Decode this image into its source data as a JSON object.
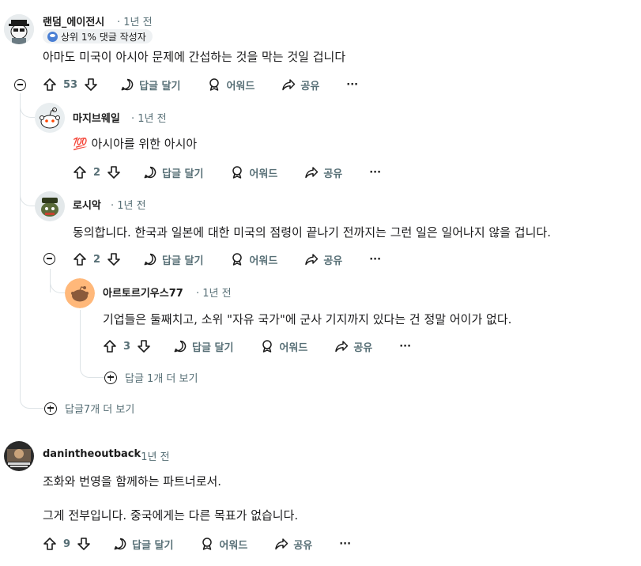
{
  "comments": [
    {
      "author": "랜덤_에이전시",
      "time": "1년 전",
      "flair": "상위 1% 댓글 작성자",
      "body": "아마도 미국이 아시아 문제에 간섭하는 것을 막는 것일 겁니다",
      "votes": "53",
      "reply": "답글 달기",
      "award": "어워드",
      "share": "공유",
      "more": "···"
    },
    {
      "author": "마지브웨일",
      "time": "1년 전",
      "emoji": "💯",
      "body": "아시아를 위한 아시아",
      "votes": "2",
      "reply": "답글 달기",
      "award": "어워드",
      "share": "공유",
      "more": "···"
    },
    {
      "author": "로시악",
      "time": "1년 전",
      "body": "동의합니다. 한국과 일본에 대한 미국의 점령이 끝나기 전까지는 그런 일은 일어나지 않을 겁니다.",
      "votes": "2",
      "reply": "답글 달기",
      "award": "어워드",
      "share": "공유",
      "more": "···"
    },
    {
      "author": "아르토르기우스77",
      "time": "1년 전",
      "body": "기업들은 둘째치고, 소위 \"자유 국가\"에 군사 기지까지 있다는 건 정말 어이가 없다.",
      "votes": "3",
      "reply": "답글 달기",
      "award": "어워드",
      "share": "공유",
      "more": "···"
    },
    {
      "author": "danintheoutback",
      "time": "1년 전",
      "body_line1": "조화와 번영을 함께하는 파트너로서.",
      "body_line2": "그게 전부입니다. 중국에게는 다른 목표가 없습니다.",
      "votes": "9",
      "reply": "답글 달기",
      "award": "어워드",
      "share": "공유",
      "more": "···"
    }
  ],
  "more_replies": {
    "nested": "답글 1개 더 보기",
    "top": "답글7개 더 보기"
  },
  "colors": {
    "text": "#1a1a1b",
    "meta": "#576f76",
    "thread_line": "#dde3e6",
    "flair_bg": "#eef1f3"
  }
}
